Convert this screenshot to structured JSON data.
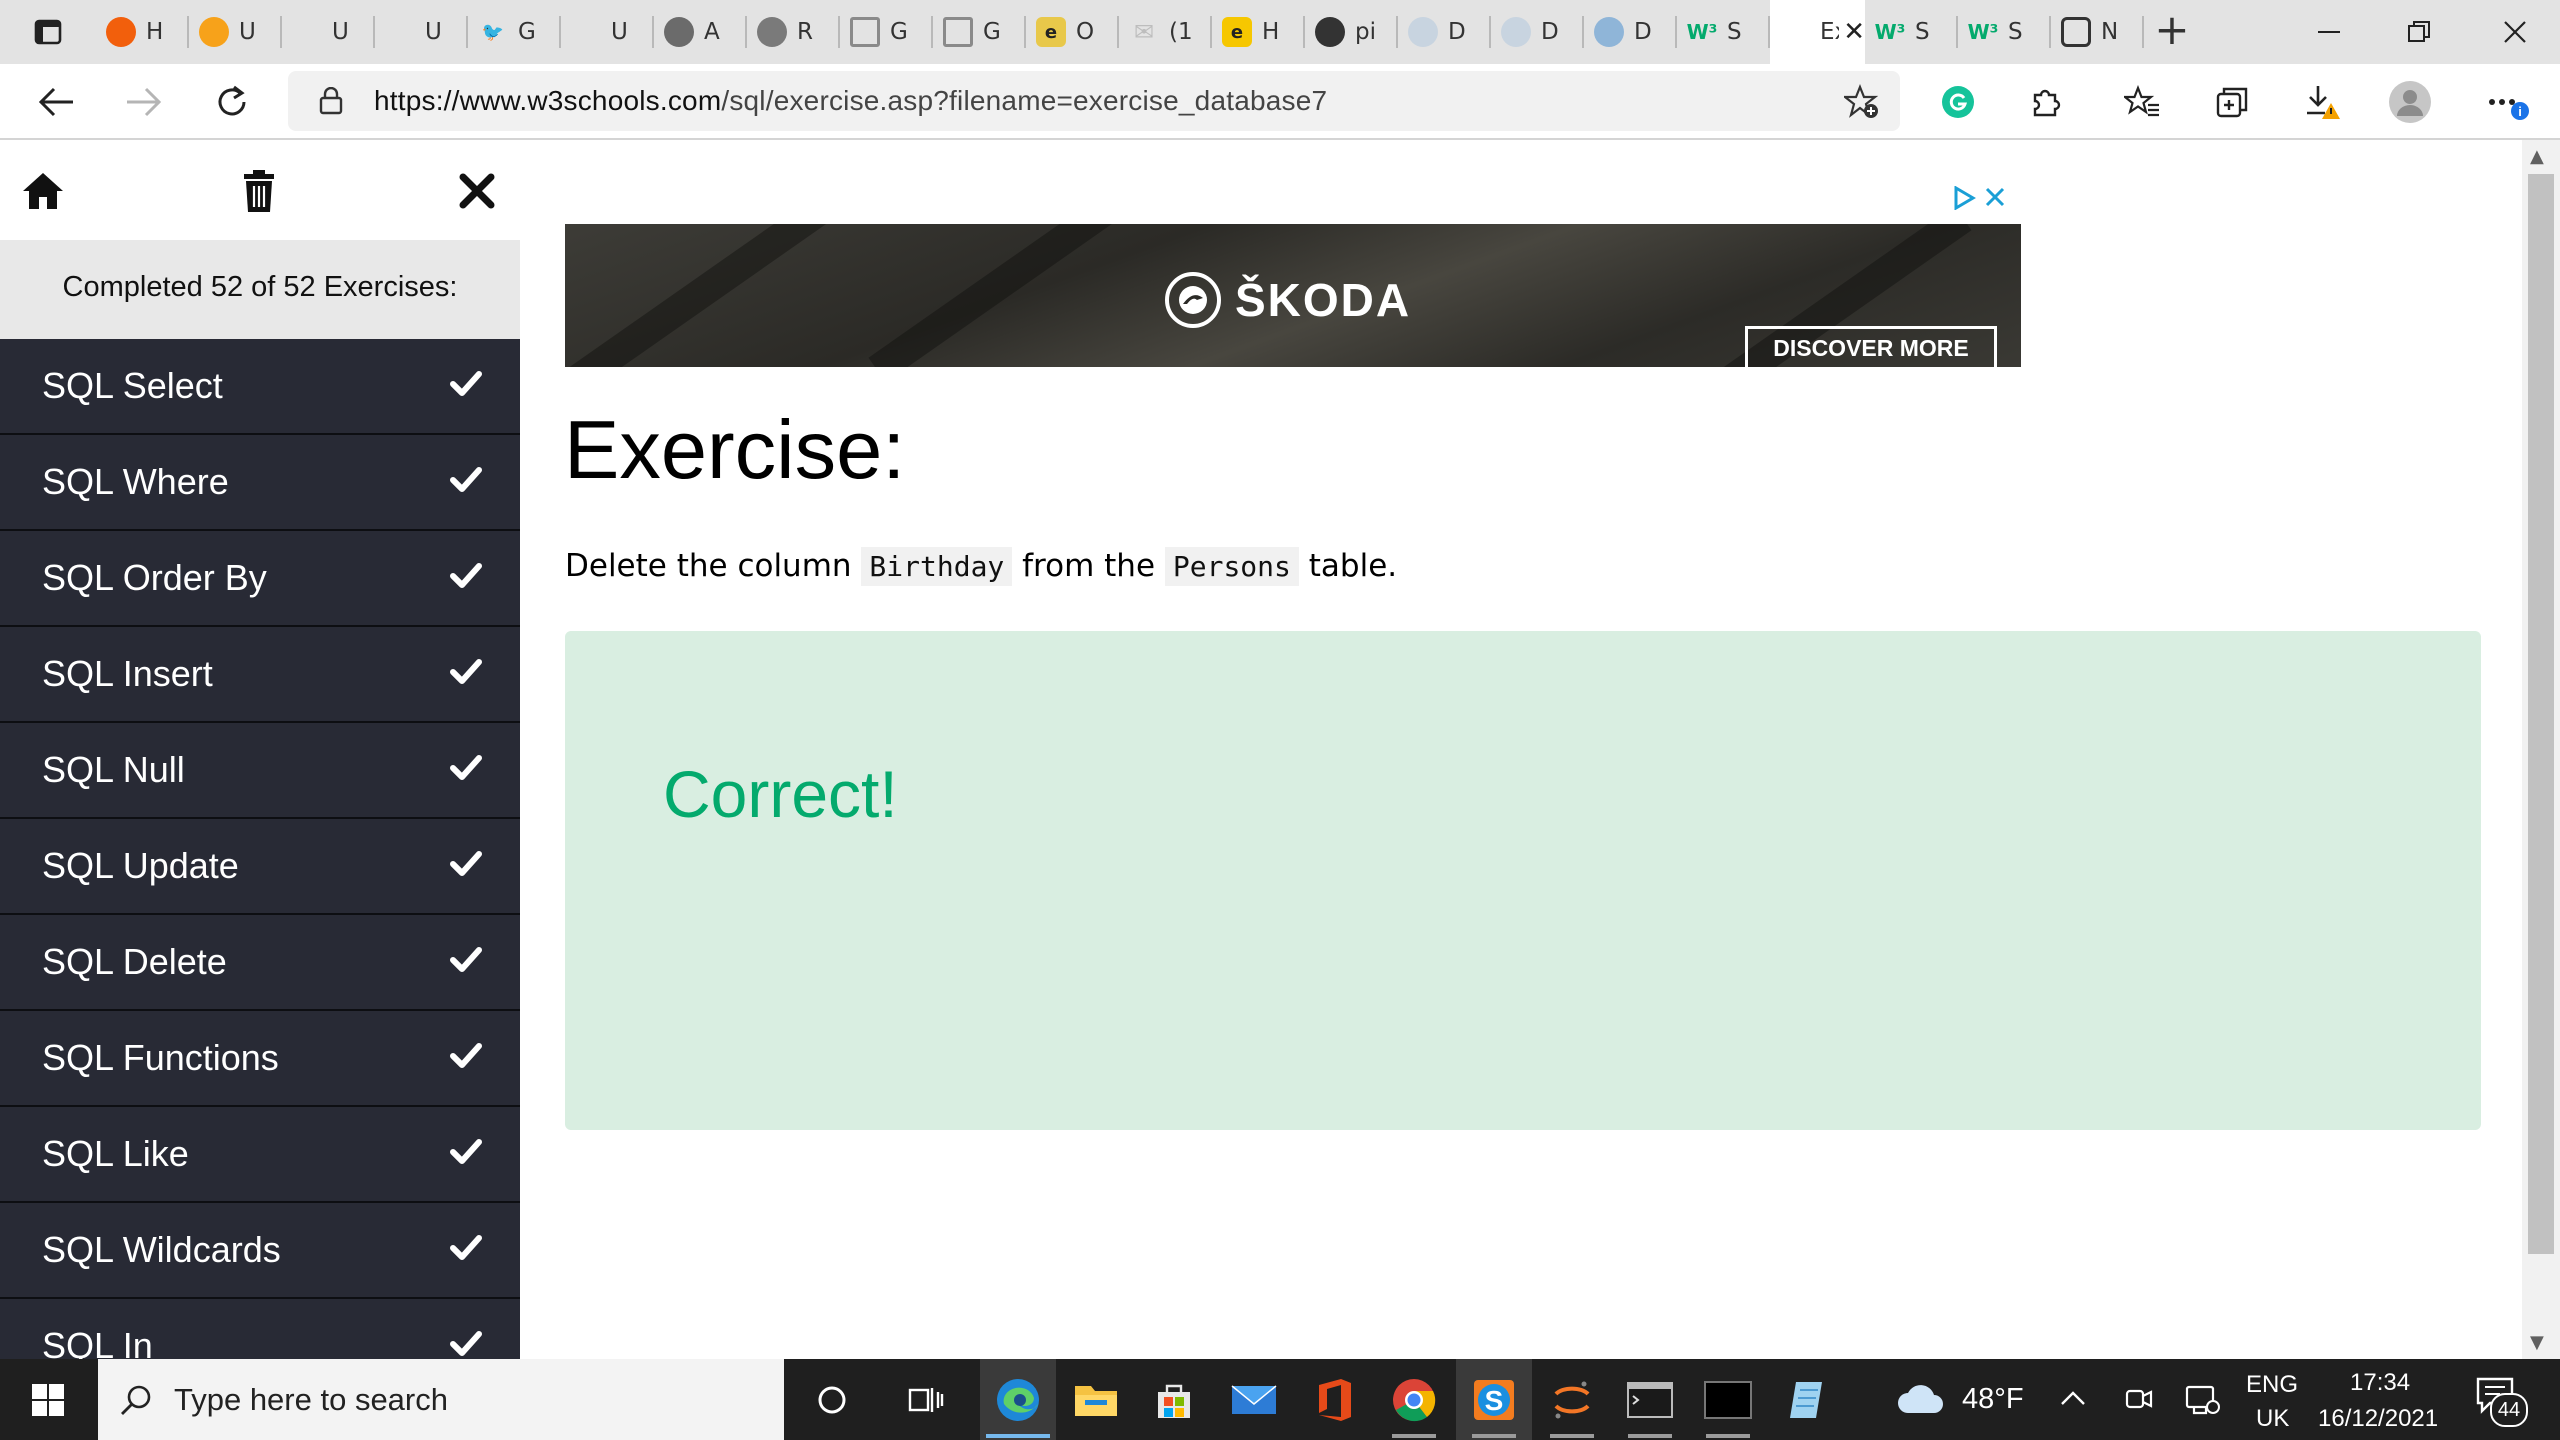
{
  "browser": {
    "tabs": [
      {
        "label": "",
        "icon": "tab-actions-icon"
      },
      {
        "label": "H",
        "icon": "loading-orange-icon",
        "color": "#f25f0c"
      },
      {
        "label": "U",
        "icon": "notes-orange-icon",
        "color": "#f7a21a"
      },
      {
        "label": "U",
        "icon": "blank-icon",
        "color": "#e3e3e3"
      },
      {
        "label": "U",
        "icon": "blank-icon",
        "color": "#e3e3e3"
      },
      {
        "label": "G",
        "icon": "twitter-icon",
        "color": "#1d9bf0"
      },
      {
        "label": "U",
        "icon": "blank-icon",
        "color": "#e3e3e3"
      },
      {
        "label": "A",
        "icon": "grey-circle-icon",
        "color": "#6b6b6b"
      },
      {
        "label": "R",
        "icon": "user-circle-icon",
        "color": "#7a7a7a"
      },
      {
        "label": "G",
        "icon": "document-grid-icon",
        "color": "#8a8a8a"
      },
      {
        "label": "G",
        "icon": "document-grid-icon",
        "color": "#8a8a8a"
      },
      {
        "label": "O",
        "icon": "e-yellow-icon",
        "color": "#e8c84a"
      },
      {
        "label": "(1",
        "icon": "mail-icon",
        "color": "#bdbdbd"
      },
      {
        "label": "H",
        "icon": "e-yellow-bold-icon",
        "color": "#f6c700"
      },
      {
        "label": "pi",
        "icon": "github-icon",
        "color": "#333333"
      },
      {
        "label": "D",
        "icon": "triangle-circle-icon",
        "color": "#c8d4e0"
      },
      {
        "label": "D",
        "icon": "triangle-circle-icon",
        "color": "#c8d4e0"
      },
      {
        "label": "D",
        "icon": "triangle-circle-icon",
        "color": "#8fb5d8"
      },
      {
        "label": "S",
        "icon": "w3schools-icon",
        "color": "#04aa6d"
      },
      {
        "label": "Ex",
        "icon": "blank-icon",
        "color": "#ffffff",
        "active": true
      },
      {
        "label": "S",
        "icon": "w3schools-icon",
        "color": "#04aa6d"
      },
      {
        "label": "S",
        "icon": "w3schools-icon",
        "color": "#04aa6d"
      },
      {
        "label": "N",
        "icon": "calendar-icon",
        "color": "#333333"
      }
    ],
    "url_host": "https://www.w3schools.com",
    "url_path": "/sql/exercise.asp?filename=exercise_database7"
  },
  "sidebar": {
    "progress_text": "Completed 52 of 52 Exercises:",
    "items": [
      {
        "label": "SQL Select",
        "completed": true
      },
      {
        "label": "SQL Where",
        "completed": true
      },
      {
        "label": "SQL Order By",
        "completed": true
      },
      {
        "label": "SQL Insert",
        "completed": true
      },
      {
        "label": "SQL Null",
        "completed": true
      },
      {
        "label": "SQL Update",
        "completed": true
      },
      {
        "label": "SQL Delete",
        "completed": true
      },
      {
        "label": "SQL Functions",
        "completed": true
      },
      {
        "label": "SQL Like",
        "completed": true
      },
      {
        "label": "SQL Wildcards",
        "completed": true
      },
      {
        "label": "SQL In",
        "completed": true
      }
    ]
  },
  "ad": {
    "brand": "ŠKODA",
    "cta": "DISCOVER MORE"
  },
  "exercise": {
    "title": "Exercise:",
    "instruction_pre": "Delete the column",
    "column_code": "Birthday",
    "instruction_mid": "from the",
    "table_code": "Persons",
    "instruction_post": "table.",
    "result": "Correct!"
  },
  "taskbar": {
    "search_placeholder": "Type here to search",
    "weather_temp": "48°F",
    "language_line1": "ENG",
    "language_line2": "UK",
    "time": "17:34",
    "date": "16/12/2021",
    "notification_count": "44"
  },
  "colors": {
    "sidebar_bg": "#282a35",
    "result_bg": "#d9eee1",
    "result_text": "#04aa6d"
  }
}
